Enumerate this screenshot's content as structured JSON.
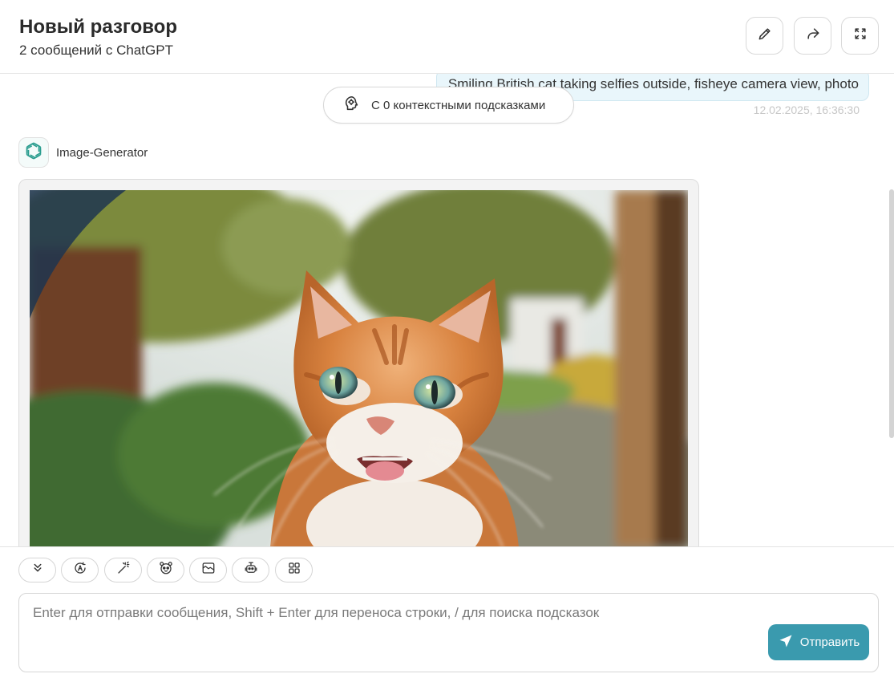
{
  "header": {
    "title": "Новый разговор",
    "subtitle": "2 сообщений с ChatGPT",
    "buttons": [
      "edit-icon",
      "share-icon",
      "fullscreen-icon"
    ]
  },
  "messages": {
    "user_text": "Smiling British cat taking selfies outside, fisheye camera view, photo",
    "user_time": "12.02.2025, 16:36:30",
    "context_pill": "С 0 контекстными подсказками",
    "bot_name": "Image-Generator"
  },
  "toolbar": {
    "icons": [
      "collapse-down-icon",
      "translate-icon",
      "magic-wand-icon",
      "mask-icon",
      "image-icon",
      "robot-icon",
      "apps-grid-icon"
    ]
  },
  "input": {
    "placeholder": "Enter для отправки сообщения, Shift + Enter для переноса строки, / для поиска подсказок",
    "send_label": "Отправить"
  },
  "colors": {
    "accent": "#3a9aae",
    "user_bubble": "#e9f6fb",
    "bot_icon": "#2a9d8f"
  }
}
